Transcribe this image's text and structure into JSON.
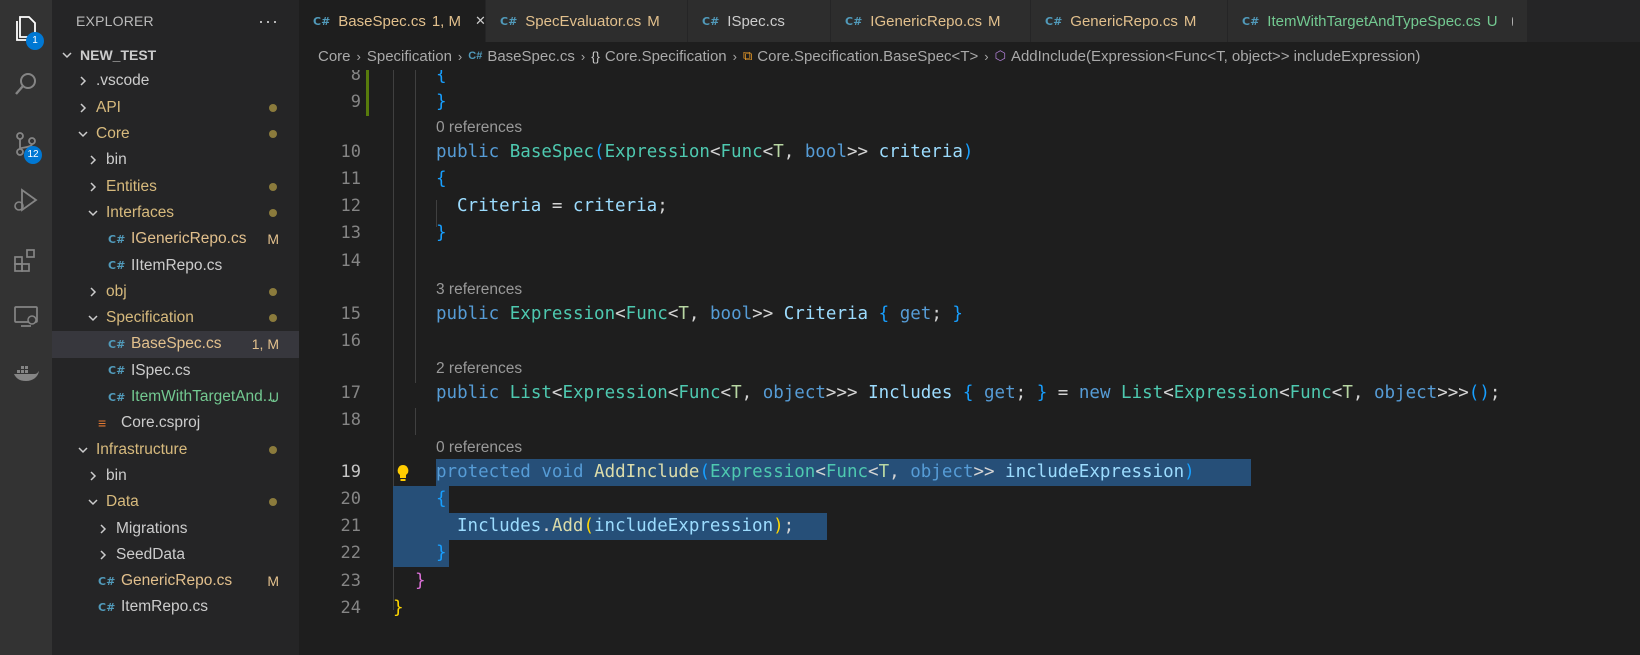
{
  "activity_bar": {
    "explorer_badge": "1",
    "scm_badge": "12"
  },
  "sidebar": {
    "title": "EXPLORER",
    "more": "···",
    "root": "NEW_TEST",
    "items": [
      {
        "label": ".vscode",
        "type": "folder",
        "expanded": false,
        "indent": 1,
        "deco": ""
      },
      {
        "label": "API",
        "type": "folder",
        "expanded": false,
        "indent": 1,
        "deco": "dot"
      },
      {
        "label": "Core",
        "type": "folder",
        "expanded": true,
        "indent": 1,
        "deco": "dot"
      },
      {
        "label": "bin",
        "type": "folder",
        "expanded": false,
        "indent": 2,
        "deco": ""
      },
      {
        "label": "Entities",
        "type": "folder",
        "expanded": false,
        "indent": 2,
        "deco": "dot"
      },
      {
        "label": "Interfaces",
        "type": "folder",
        "expanded": true,
        "indent": 2,
        "deco": "dot"
      },
      {
        "label": "IGenericRepo.cs",
        "type": "cs",
        "indent": 3,
        "deco": "M"
      },
      {
        "label": "IItemRepo.cs",
        "type": "cs",
        "indent": 3,
        "deco": ""
      },
      {
        "label": "obj",
        "type": "folder",
        "expanded": false,
        "indent": 2,
        "deco": "dot"
      },
      {
        "label": "Specification",
        "type": "folder",
        "expanded": true,
        "indent": 2,
        "deco": "dot"
      },
      {
        "label": "BaseSpec.cs",
        "type": "cs",
        "indent": 3,
        "deco": "1, M"
      },
      {
        "label": "ISpec.cs",
        "type": "cs",
        "indent": 3,
        "deco": ""
      },
      {
        "label": "ItemWithTargetAnd...",
        "type": "cs",
        "indent": 3,
        "deco": "U"
      },
      {
        "label": "Core.csproj",
        "type": "rss",
        "indent": 2,
        "deco": ""
      },
      {
        "label": "Infrastructure",
        "type": "folder",
        "expanded": true,
        "indent": 1,
        "deco": "dot"
      },
      {
        "label": "bin",
        "type": "folder",
        "expanded": false,
        "indent": 2,
        "deco": ""
      },
      {
        "label": "Data",
        "type": "folder",
        "expanded": true,
        "indent": 2,
        "deco": "dot"
      },
      {
        "label": "Migrations",
        "type": "folder",
        "expanded": false,
        "indent": 3,
        "deco": ""
      },
      {
        "label": "SeedData",
        "type": "folder",
        "expanded": false,
        "indent": 3,
        "deco": ""
      },
      {
        "label": "GenericRepo.cs",
        "type": "cs",
        "indent": 2,
        "deco": "M"
      },
      {
        "label": "ItemRepo.cs",
        "type": "cs",
        "indent": 2,
        "deco": ""
      }
    ]
  },
  "tabs": [
    {
      "label": "BaseSpec.cs",
      "deco": "1, M",
      "active": true,
      "status": "mod"
    },
    {
      "label": "SpecEvaluator.cs",
      "deco": "M",
      "active": false,
      "status": "mod"
    },
    {
      "label": "ISpec.cs",
      "deco": "",
      "active": false,
      "status": "plain"
    },
    {
      "label": "IGenericRepo.cs",
      "deco": "M",
      "active": false,
      "status": "mod"
    },
    {
      "label": "GenericRepo.cs",
      "deco": "M",
      "active": false,
      "status": "mod"
    },
    {
      "label": "ItemWithTargetAndTypeSpec.cs",
      "deco": "U",
      "active": false,
      "status": "new"
    }
  ],
  "breadcrumb": [
    "Core",
    "Specification",
    "BaseSpec.cs",
    "Core.Specification",
    "Core.Specification.BaseSpec<T>",
    "AddInclude(Expression<Func<T, object>> includeExpression)"
  ],
  "editor": {
    "codelens": [
      "0 references",
      "3 references",
      "2 references",
      "0 references"
    ],
    "line_numbers": [
      "8",
      "9",
      "10",
      "11",
      "12",
      "13",
      "14",
      "15",
      "16",
      "17",
      "18",
      "19",
      "20",
      "21",
      "22",
      "23",
      "24"
    ]
  },
  "colors": {
    "keyword": "#569cd6",
    "type": "#4ec9b0",
    "identifier": "#9cdcfe",
    "method": "#dcdcaa",
    "selection": "#264f78",
    "modified": "#e2c08d",
    "untracked": "#73c991"
  }
}
